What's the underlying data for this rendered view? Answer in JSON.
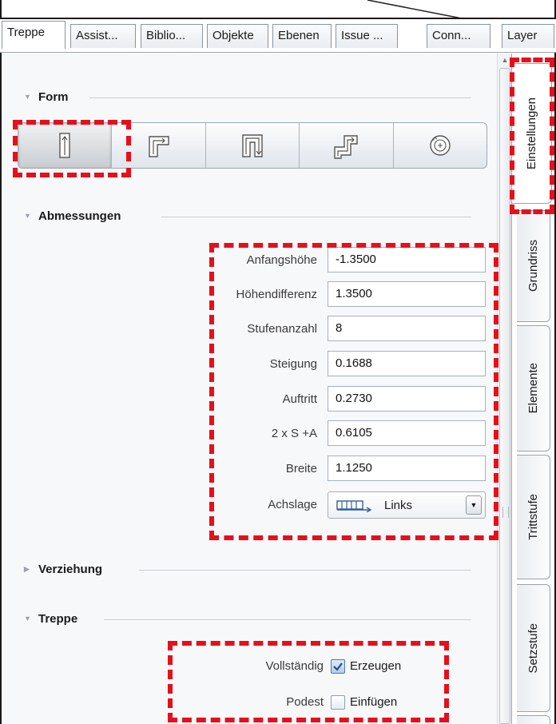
{
  "top_tabs": [
    {
      "label": "Treppe",
      "active": true
    },
    {
      "label": "Assist..."
    },
    {
      "label": "Biblio..."
    },
    {
      "label": "Objekte"
    },
    {
      "label": "Ebenen"
    },
    {
      "label": "Issue ..."
    },
    {
      "label": "Conn..."
    },
    {
      "label": "Layer"
    }
  ],
  "sections": {
    "form": {
      "title": "Form"
    },
    "abmessungen": {
      "title": "Abmessungen"
    },
    "verziehung": {
      "title": "Verziehung"
    },
    "treppe": {
      "title": "Treppe"
    }
  },
  "form_shapes": [
    {
      "icon": "straight-stair-icon",
      "selected": true
    },
    {
      "icon": "l-shaped-stair-icon"
    },
    {
      "icon": "u-shaped-stair-icon"
    },
    {
      "icon": "z-shaped-stair-icon"
    },
    {
      "icon": "spiral-stair-icon"
    }
  ],
  "dimensions": [
    {
      "label": "Anfangshöhe",
      "value": "-1.3500"
    },
    {
      "label": "Höhendifferenz",
      "value": "1.3500"
    },
    {
      "label": "Stufenanzahl",
      "value": "8"
    },
    {
      "label": "Steigung",
      "value": "0.1688"
    },
    {
      "label": "Auftritt",
      "value": "0.2730"
    },
    {
      "label": "2 x S +A",
      "value": "0.6105"
    },
    {
      "label": "Breite",
      "value": "1.1250"
    },
    {
      "label": "Achslage",
      "value": "Links",
      "icon": "axis-position-icon"
    }
  ],
  "treppe_options": [
    {
      "label": "Vollständig",
      "checkbox_text": "Erzeugen",
      "checked": true
    },
    {
      "label": "Podest",
      "checkbox_text": "Einfügen",
      "checked": false
    }
  ],
  "side_tabs": [
    {
      "label": "Einstellungen",
      "active": true
    },
    {
      "label": "Grundriss"
    },
    {
      "label": "Elemente"
    },
    {
      "label": "Trittstufe"
    },
    {
      "label": "Setzstufe"
    }
  ],
  "colors": {
    "highlight": "#e4101c",
    "accent_check": "#2f5f9e"
  }
}
